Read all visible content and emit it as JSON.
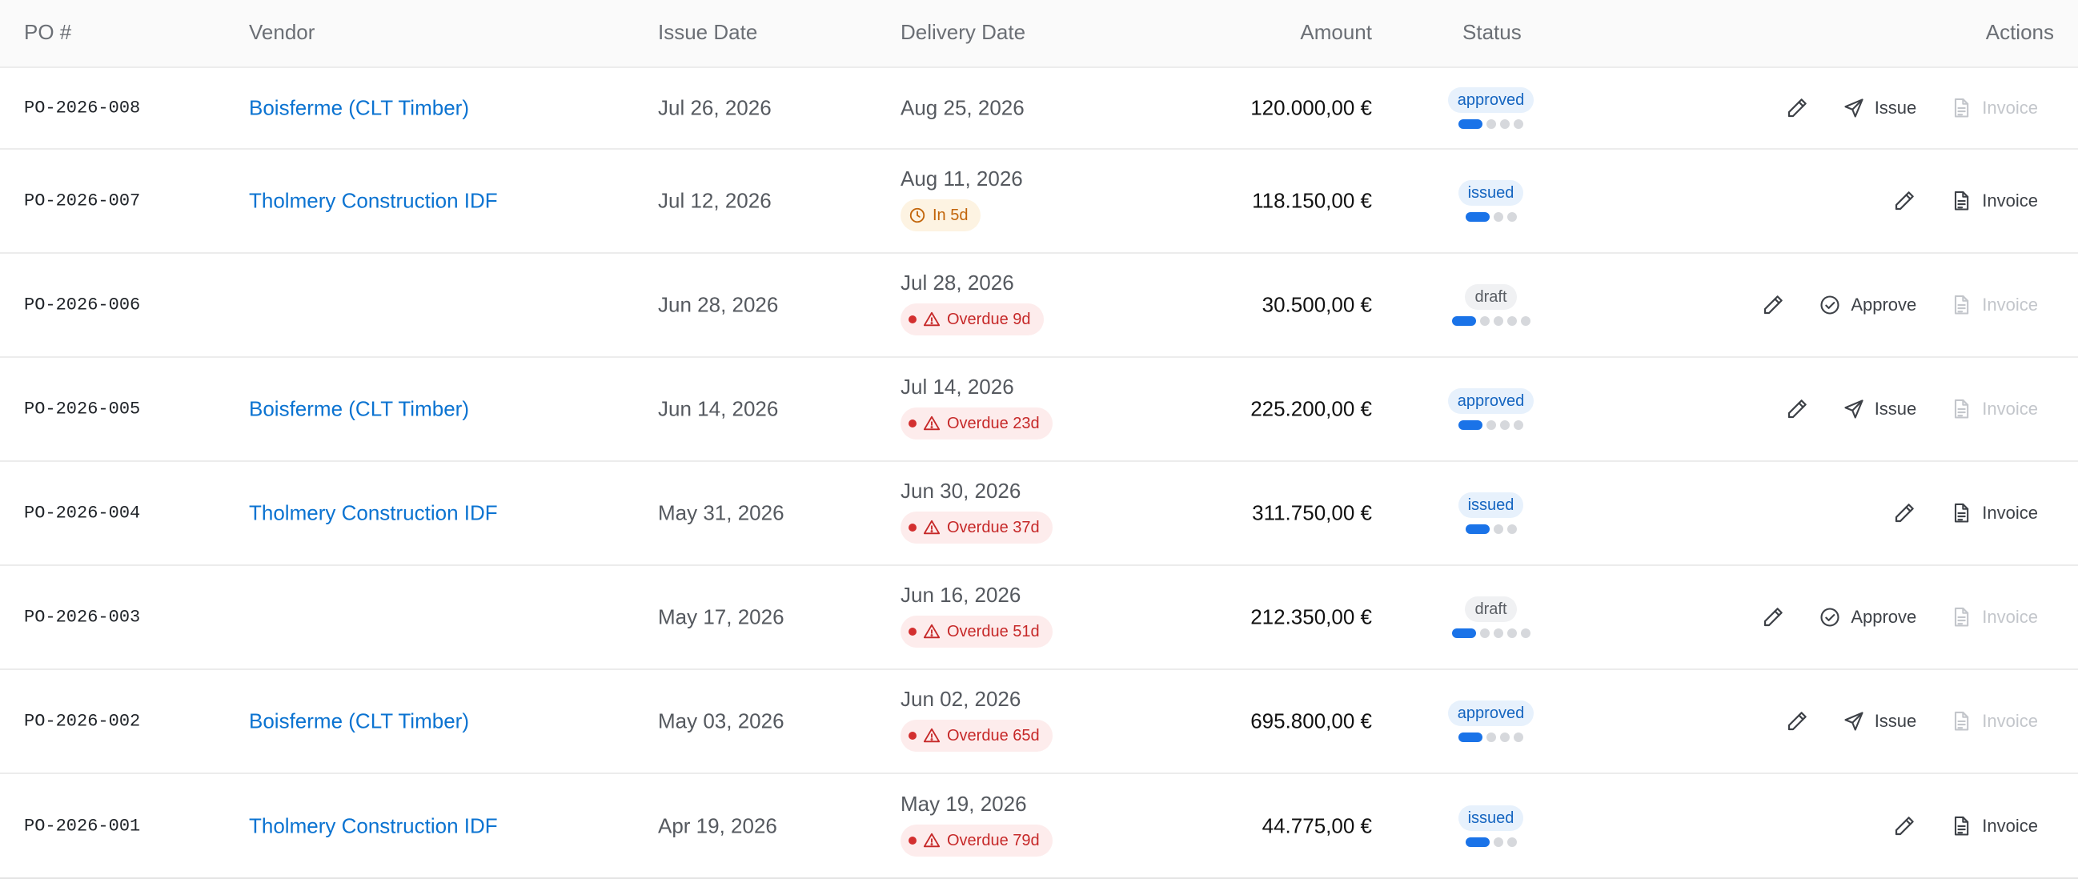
{
  "header": {
    "po": "PO #",
    "vendor": "Vendor",
    "issue_date": "Issue Date",
    "delivery_date": "Delivery Date",
    "amount": "Amount",
    "status": "Status",
    "actions": "Actions"
  },
  "rows": [
    {
      "po": "PO-2026-008",
      "vendor": "Boisferme (CLT Timber)",
      "issue": "Jul 26, 2026",
      "delivery": "Aug 25, 2026",
      "chip": null,
      "amount": "120.000,00 €",
      "status": "approved",
      "progress": {
        "done": 1,
        "total": 4
      },
      "primary": "Issue",
      "invoice": "Invoice",
      "invoice_enabled": false
    },
    {
      "po": "PO-2026-007",
      "vendor": "Tholmery Construction IDF",
      "issue": "Jul 12, 2026",
      "delivery": "Aug 11, 2026",
      "chip": {
        "kind": "warn",
        "text": "In 5d"
      },
      "amount": "118.150,00 €",
      "status": "issued",
      "progress": {
        "done": 1,
        "total": 3
      },
      "primary": null,
      "invoice": "Invoice",
      "invoice_enabled": true
    },
    {
      "po": "PO-2026-006",
      "vendor": "",
      "issue": "Jun 28, 2026",
      "delivery": "Jul 28, 2026",
      "chip": {
        "kind": "over",
        "text": "Overdue 9d"
      },
      "amount": "30.500,00 €",
      "status": "draft",
      "progress": {
        "done": 1,
        "total": 5
      },
      "primary": "Approve",
      "invoice": "Invoice",
      "invoice_enabled": false
    },
    {
      "po": "PO-2026-005",
      "vendor": "Boisferme (CLT Timber)",
      "issue": "Jun 14, 2026",
      "delivery": "Jul 14, 2026",
      "chip": {
        "kind": "over",
        "text": "Overdue 23d"
      },
      "amount": "225.200,00 €",
      "status": "approved",
      "progress": {
        "done": 1,
        "total": 4
      },
      "primary": "Issue",
      "invoice": "Invoice",
      "invoice_enabled": false
    },
    {
      "po": "PO-2026-004",
      "vendor": "Tholmery Construction IDF",
      "issue": "May 31, 2026",
      "delivery": "Jun 30, 2026",
      "chip": {
        "kind": "over",
        "text": "Overdue 37d"
      },
      "amount": "311.750,00 €",
      "status": "issued",
      "progress": {
        "done": 1,
        "total": 3
      },
      "primary": null,
      "invoice": "Invoice",
      "invoice_enabled": true
    },
    {
      "po": "PO-2026-003",
      "vendor": "",
      "issue": "May 17, 2026",
      "delivery": "Jun 16, 2026",
      "chip": {
        "kind": "over",
        "text": "Overdue 51d"
      },
      "amount": "212.350,00 €",
      "status": "draft",
      "progress": {
        "done": 1,
        "total": 5
      },
      "primary": "Approve",
      "invoice": "Invoice",
      "invoice_enabled": false
    },
    {
      "po": "PO-2026-002",
      "vendor": "Boisferme (CLT Timber)",
      "issue": "May 03, 2026",
      "delivery": "Jun 02, 2026",
      "chip": {
        "kind": "over",
        "text": "Overdue 65d"
      },
      "amount": "695.800,00 €",
      "status": "approved",
      "progress": {
        "done": 1,
        "total": 4
      },
      "primary": "Issue",
      "invoice": "Invoice",
      "invoice_enabled": false
    },
    {
      "po": "PO-2026-001",
      "vendor": "Tholmery Construction IDF",
      "issue": "Apr 19, 2026",
      "delivery": "May 19, 2026",
      "chip": {
        "kind": "over",
        "text": "Overdue 79d"
      },
      "amount": "44.775,00 €",
      "status": "issued",
      "progress": {
        "done": 1,
        "total": 3
      },
      "primary": null,
      "invoice": "Invoice",
      "invoice_enabled": true
    }
  ],
  "colors": {
    "link": "#0b73d1",
    "accent": "#1a73e8",
    "overdue": "#c62828",
    "warning": "#c2650a"
  }
}
